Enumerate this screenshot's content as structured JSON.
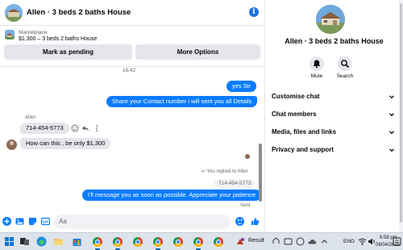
{
  "header": {
    "title": "Allen · 3 beds 2 baths House"
  },
  "marketplace": {
    "category": "Marketplace",
    "description": "$1,300 – 3 beds 2 baths House",
    "mark_pending": "Mark as pending",
    "more_options": "More Options"
  },
  "messages": {
    "time": "18:42",
    "out1": "yes Sir",
    "out2": "Share your Contact number i will sent you all Details",
    "sender": "Allen",
    "in1": "714-454-5773",
    "in2": "How can this , be only $1,300",
    "replied": "You replied to Allen",
    "quoted": "714-454-5773",
    "out3": "I'll message you as soon as possible. Appreciate your patience",
    "status": "Sent"
  },
  "composer": {
    "placeholder": "Aa"
  },
  "side": {
    "title": "Allen · 3 beds 2 baths House",
    "mute": "Mute",
    "search": "Search",
    "sections": [
      "Customise chat",
      "Chat members",
      "Media, files and links",
      "Privacy and support"
    ]
  },
  "taskbar": {
    "search_label": "Result",
    "language": "ENG",
    "time": "6:58 pm",
    "date": "08/04/2025"
  },
  "colors": {
    "messenger_blue": "#0a7cff",
    "bubble_grey": "#e4e6eb",
    "taskbar": "#dde3ea"
  }
}
